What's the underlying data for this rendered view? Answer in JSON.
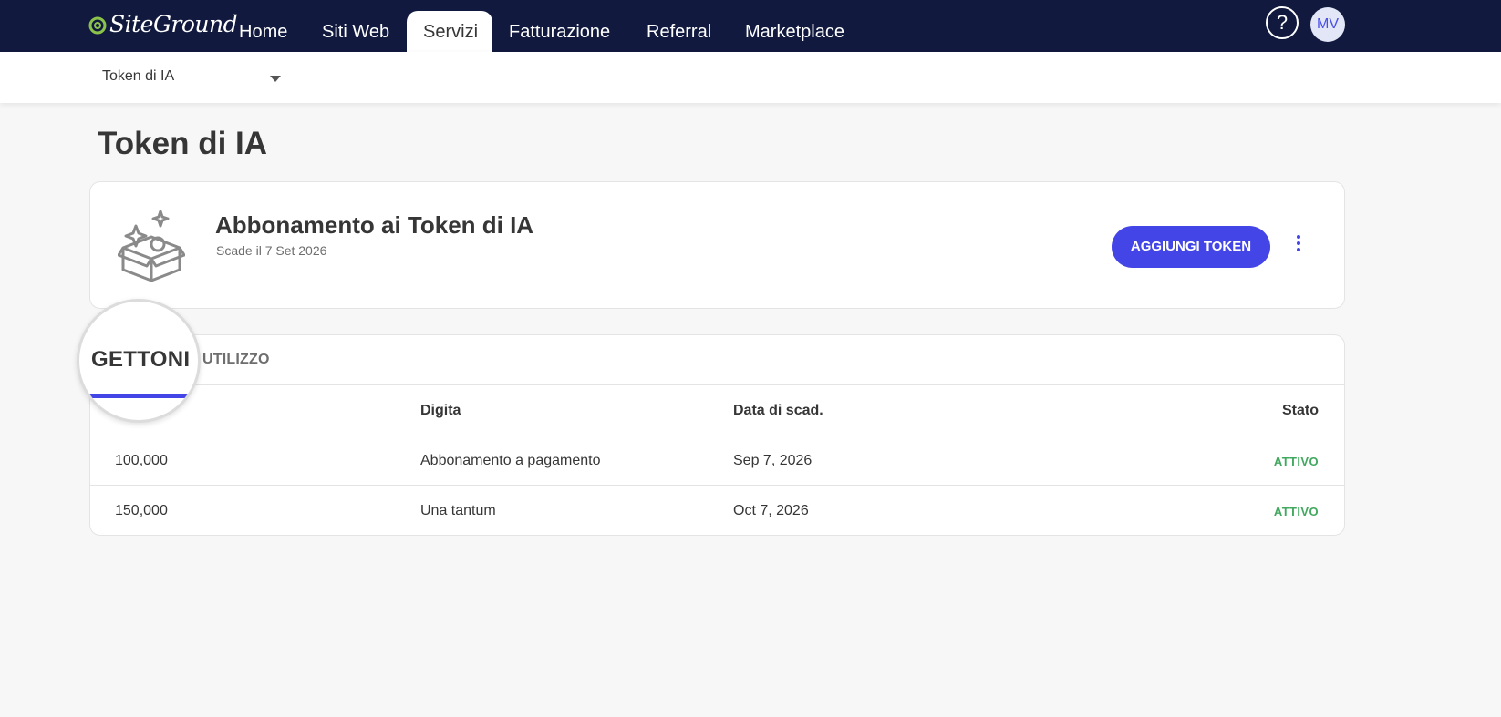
{
  "brand": {
    "name": "SiteGround"
  },
  "nav": {
    "items": [
      {
        "label": "Home",
        "active": false
      },
      {
        "label": "Siti Web",
        "active": false
      },
      {
        "label": "Servizi",
        "active": true
      },
      {
        "label": "Fatturazione",
        "active": false
      },
      {
        "label": "Referral",
        "active": false
      },
      {
        "label": "Marketplace",
        "active": false
      }
    ],
    "help_symbol": "?",
    "avatar_initials": "MV"
  },
  "subbar": {
    "selected": "Token di IA"
  },
  "page": {
    "title": "Token di IA"
  },
  "subscription": {
    "title": "Abbonamento ai Token di IA",
    "expiry": "Scade il 7 Set 2026",
    "add_button": "AGGIUNGI TOKEN"
  },
  "tabs": [
    {
      "label": "GETTONI",
      "active": true
    },
    {
      "label": "UTILIZZO",
      "active": false
    }
  ],
  "table": {
    "headers": [
      "",
      "Digita",
      "Data di scad.",
      "Stato"
    ],
    "rows": [
      {
        "amount": "100,000",
        "type": "Abbonamento a pagamento",
        "expiry": "Sep 7, 2026",
        "status": "ATTIVO"
      },
      {
        "amount": "150,000",
        "type": "Una tantum",
        "expiry": "Oct 7, 2026",
        "status": "ATTIVO"
      }
    ]
  },
  "colors": {
    "nav_bg": "#111a3e",
    "accent": "#4345e6",
    "status_active": "#42a85f",
    "logo_green": "#8bc34a"
  }
}
